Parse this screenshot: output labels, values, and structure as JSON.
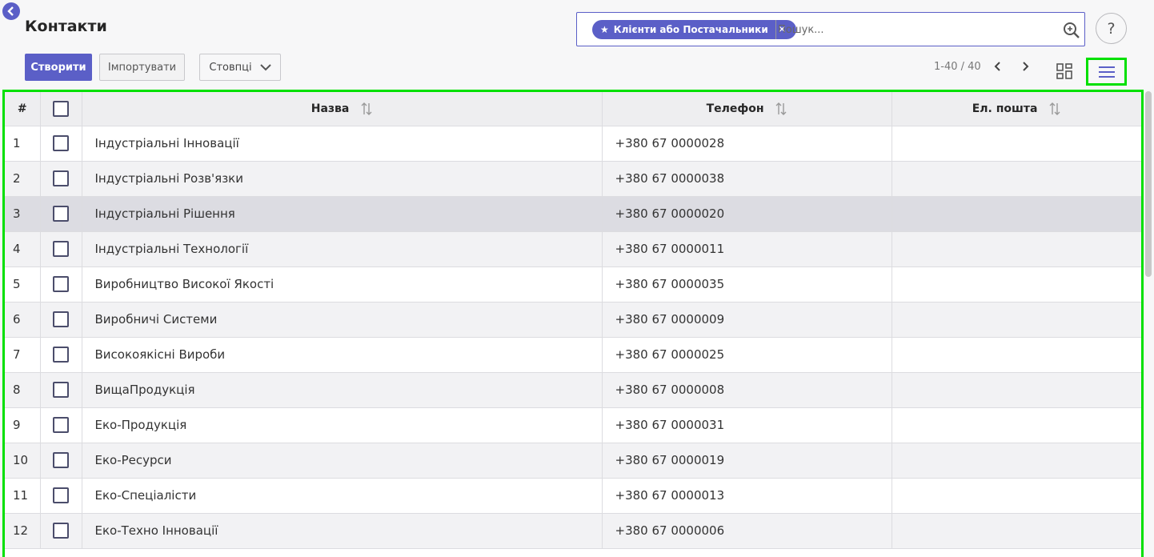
{
  "page": {
    "title": "Контакти"
  },
  "toolbar": {
    "create_label": "Створити",
    "import_label": "Імпортувати",
    "columns_label": "Стовпці"
  },
  "search": {
    "facet_label": "Клієнти або Постачальники",
    "placeholder": "Пошук..."
  },
  "pager": {
    "text": "1-40 / 40"
  },
  "help_label": "?",
  "table": {
    "headers": {
      "num": "#",
      "name": "Назва",
      "phone": "Телефон",
      "email": "Ел. пошта"
    },
    "rows": [
      {
        "num": "1",
        "name": "Індустріальні Інновації",
        "phone": "+380 67 0000028",
        "email": ""
      },
      {
        "num": "2",
        "name": "Індустріальні Розв'язки",
        "phone": "+380 67 0000038",
        "email": ""
      },
      {
        "num": "3",
        "name": "Індустріальні Рішення",
        "phone": "+380 67 0000020",
        "email": ""
      },
      {
        "num": "4",
        "name": "Індустріальні Технології",
        "phone": "+380 67 0000011",
        "email": ""
      },
      {
        "num": "5",
        "name": "Виробництво Високої Якості",
        "phone": "+380 67 0000035",
        "email": ""
      },
      {
        "num": "6",
        "name": "Виробничі Системи",
        "phone": "+380 67 0000009",
        "email": ""
      },
      {
        "num": "7",
        "name": "Високоякісні Вироби",
        "phone": "+380 67 0000025",
        "email": ""
      },
      {
        "num": "8",
        "name": "ВищаПродукція",
        "phone": "+380 67 0000008",
        "email": ""
      },
      {
        "num": "9",
        "name": "Еко-Продукція",
        "phone": "+380 67 0000031",
        "email": ""
      },
      {
        "num": "10",
        "name": "Еко-Ресурси",
        "phone": "+380 67 0000019",
        "email": ""
      },
      {
        "num": "11",
        "name": "Еко-Спеціалісти",
        "phone": "+380 67 0000013",
        "email": ""
      },
      {
        "num": "12",
        "name": "Еко-Техно Інновації",
        "phone": "+380 67 0000006",
        "email": ""
      }
    ]
  },
  "colors": {
    "accent": "#5b5fc7",
    "highlight": "#00e000"
  }
}
